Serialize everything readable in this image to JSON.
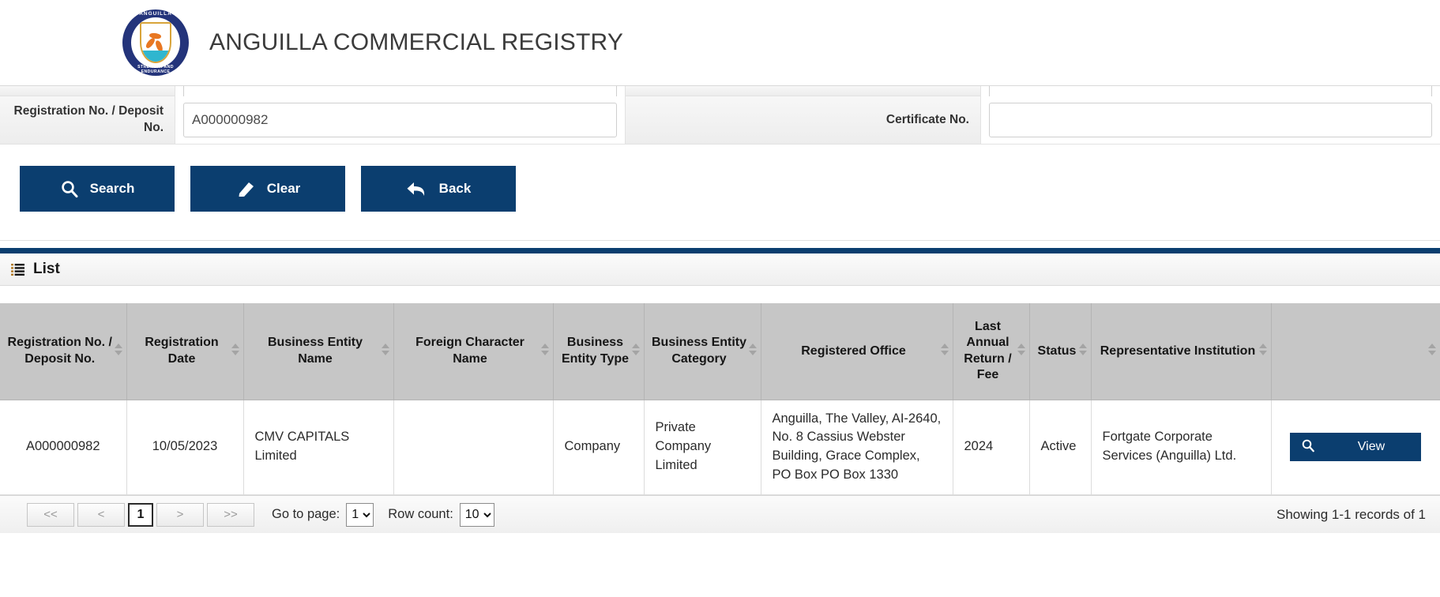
{
  "header": {
    "title": "ANGUILLA COMMERCIAL REGISTRY",
    "crest_top_text": "ANGUILLA",
    "crest_bottom_text": "STRENGTH AND ENDURANCE"
  },
  "search_form": {
    "fields": [
      {
        "label": "Registration No. / Deposit No.",
        "value": "A000000982",
        "placeholder": ""
      },
      {
        "label": "Certificate No.",
        "value": "",
        "placeholder": ""
      }
    ]
  },
  "buttons": {
    "search": "Search",
    "clear": "Clear",
    "back": "Back"
  },
  "list_panel": {
    "title": "List"
  },
  "table": {
    "columns": [
      "Registration No. / Deposit No.",
      "Registration Date",
      "Business Entity Name",
      "Foreign Character Name",
      "Business Entity Type",
      "Business Entity Category",
      "Registered Office",
      "Last Annual Return / Fee",
      "Status",
      "Representative Institution",
      ""
    ],
    "rows": [
      {
        "registration_no": "A000000982",
        "registration_date": "10/05/2023",
        "business_entity_name": "CMV CAPITALS Limited",
        "foreign_character_name": "",
        "business_entity_type": "Company",
        "business_entity_category": "Private Company Limited",
        "registered_office": "Anguilla, The Valley, AI-2640, No. 8 Cassius Webster Building, Grace Complex, PO Box PO Box 1330",
        "last_annual_return_fee": "2024",
        "status": "Active",
        "representative_institution": "Fortgate Corporate Services (Anguilla) Ltd.",
        "action_label": "View"
      }
    ]
  },
  "pager": {
    "first": "<<",
    "prev": "<",
    "current_page": "1",
    "next": ">",
    "last": ">>",
    "goto_label": "Go to page:",
    "goto_value": "1",
    "rowcount_label": "Row count:",
    "rowcount_value": "10",
    "showing": "Showing 1-1 records of 1"
  },
  "colors": {
    "brand_navy": "#0b3e6f",
    "header_gray": "#c6c6c6",
    "crest_blue": "#24347b",
    "crest_orange": "#e87722",
    "crest_teal": "#2fb6cf"
  }
}
